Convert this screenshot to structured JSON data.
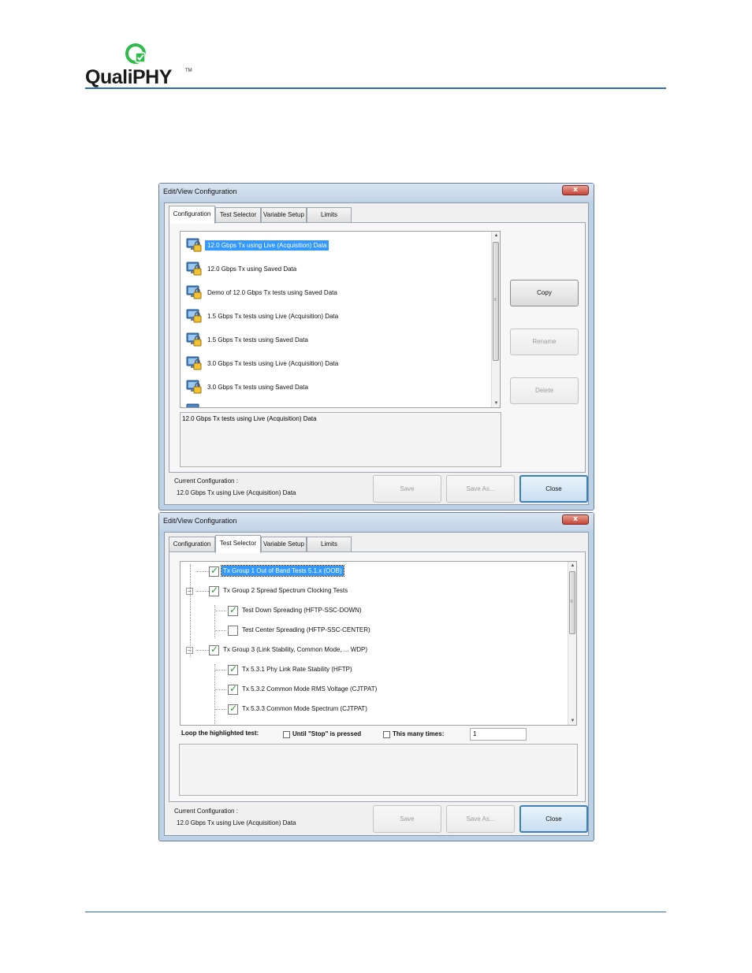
{
  "header": {
    "brand": "QualiPHY",
    "trademark": "TM"
  },
  "config_dialog": {
    "title": "Edit/View Configuration",
    "close_glyph": "x",
    "tabs": [
      "Configuration",
      "Test Selector",
      "Variable Setup",
      "Limits"
    ],
    "active_tab": "Configuration",
    "configurations": [
      "12.0 Gbps Tx using Live (Acquisition) Data",
      "12.0 Gbps Tx using Saved Data",
      "Demo of 12.0 Gbps Tx tests using  Saved Data",
      "1.5 Gbps Tx tests using Live (Acquisition) Data",
      "1.5 Gbps Tx tests using Saved Data",
      "3.0 Gbps Tx tests using Live (Acquisition) Data",
      "3.0 Gbps Tx tests using Saved Data"
    ],
    "selected_configuration": "12.0 Gbps Tx using Live (Acquisition) Data",
    "description": "12.0 Gbps Tx tests using Live (Acquisition) Data",
    "buttons": {
      "copy": "Copy",
      "rename": "Rename",
      "delete": "Delete",
      "save": "Save",
      "save_as": "Save As...",
      "close": "Close"
    },
    "current_config_label": "Current Configuration :",
    "current_config_value": "12.0 Gbps Tx using Live (Acquisition) Data"
  },
  "test_dialog": {
    "title": "Edit/View Configuration",
    "close_glyph": "x",
    "tabs": [
      "Configuration",
      "Test Selector",
      "Variable Setup",
      "Limits"
    ],
    "active_tab": "Test Selector",
    "tree": [
      {
        "label": "Tx Group 1 Out of Band Tests 5.1.x  (OOB)",
        "checked": true,
        "level": 0,
        "selected": true
      },
      {
        "label": "Tx Group 2 Spread Spectrum Clocking Tests",
        "checked": true,
        "level": 0,
        "expander": "−"
      },
      {
        "label": "Test Down Spreading (HFTP-SSC-DOWN)",
        "checked": true,
        "level": 1
      },
      {
        "label": "Test Center Spreading (HFTP-SSC-CENTER)",
        "checked": false,
        "level": 1
      },
      {
        "label": "Tx Group 3 (Link Stability, Common Mode, ... WDP)",
        "checked": true,
        "level": 0,
        "expander": "−"
      },
      {
        "label": "Tx 5.3.1 Phy Link Rate Stability (HFTP)",
        "checked": true,
        "level": 1
      },
      {
        "label": "Tx 5.3.2 Common Mode RMS Voltage (CJTPAT)",
        "checked": true,
        "level": 1
      },
      {
        "label": "Tx 5.3.3 Common Mode Spectrum (CJTPAT)",
        "checked": true,
        "level": 1
      }
    ],
    "loop": {
      "label": "Loop the highlighted test:",
      "until_stop": "Until \"Stop\" is pressed",
      "many_times": "This many times:",
      "count": "1"
    },
    "buttons": {
      "save": "Save",
      "save_as": "Save As...",
      "close": "Close"
    },
    "current_config_label": "Current Configuration :",
    "current_config_value": "12.0 Gbps Tx using Live (Acquisition) Data"
  },
  "colors": {
    "accent_rule": "#2e6eb5",
    "selection": "#3399ff",
    "check": "#2e9a2e",
    "logo_green": "#2dbb4a"
  },
  "icons": {
    "logo": "qualiphy-check-logo",
    "config": "monitor-lock-icon",
    "checkbox": "check-icon"
  }
}
